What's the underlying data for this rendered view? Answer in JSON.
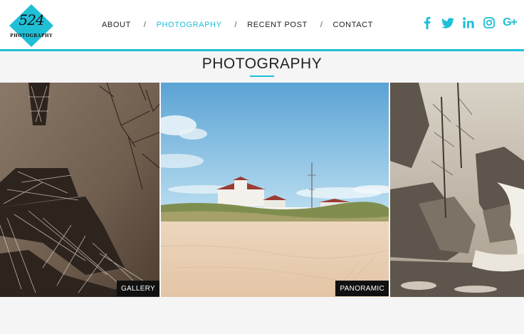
{
  "brand": {
    "logo_line1": "524",
    "logo_line2": "PHOTOGRAPHY",
    "accent_color": "#1fbfd6"
  },
  "nav": {
    "items": [
      {
        "label": "ABOUT",
        "active": false
      },
      {
        "label": "PHOTOGRAPHY",
        "active": true
      },
      {
        "label": "RECENT POST",
        "active": false
      },
      {
        "label": "CONTACT",
        "active": false
      }
    ],
    "separator": "/"
  },
  "social": {
    "icons": [
      "facebook-icon",
      "twitter-icon",
      "linkedin-icon",
      "instagram-icon",
      "google-plus-icon"
    ],
    "gplus_text": "G+"
  },
  "section": {
    "title": "PHOTOGRAPHY"
  },
  "gallery": {
    "tiles": [
      {
        "subject": "eiffel-tower-photo",
        "label": "GALLERY"
      },
      {
        "subject": "beach-lighthouse-photo",
        "label": "PANORAMIC"
      },
      {
        "subject": "waterfall-photo",
        "label": ""
      }
    ]
  }
}
